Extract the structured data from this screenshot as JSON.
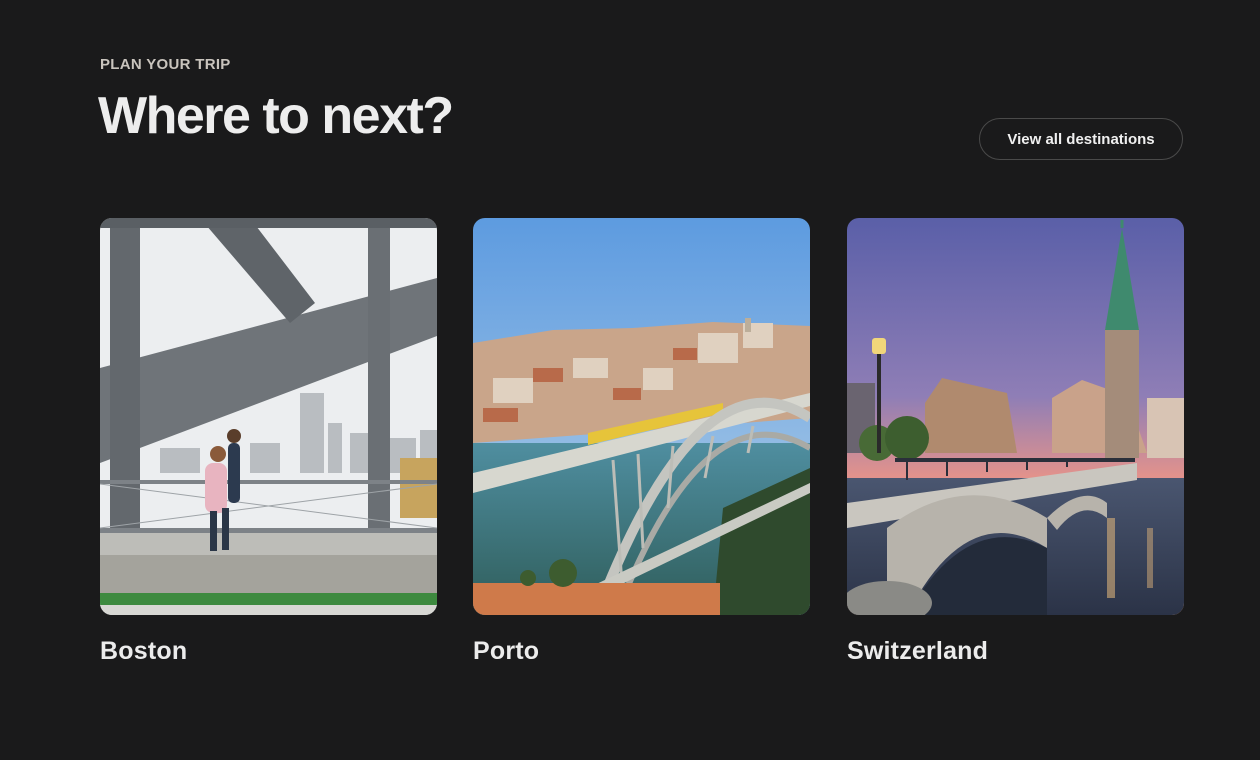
{
  "section": {
    "eyebrow": "PLAN YOUR TRIP",
    "title": "Where to next?",
    "view_all_label": "View all destinations"
  },
  "destinations": [
    {
      "name": "Boston",
      "image": "bridge-walkers-photo"
    },
    {
      "name": "Porto",
      "image": "river-bridge-city-photo"
    },
    {
      "name": "Switzerland",
      "image": "stone-bridge-church-photo"
    }
  ],
  "colors": {
    "background": "#1a1a1b",
    "heading": "#ededed",
    "eyebrow": "#c9c4bd",
    "button_border": "#4a4a4a"
  }
}
